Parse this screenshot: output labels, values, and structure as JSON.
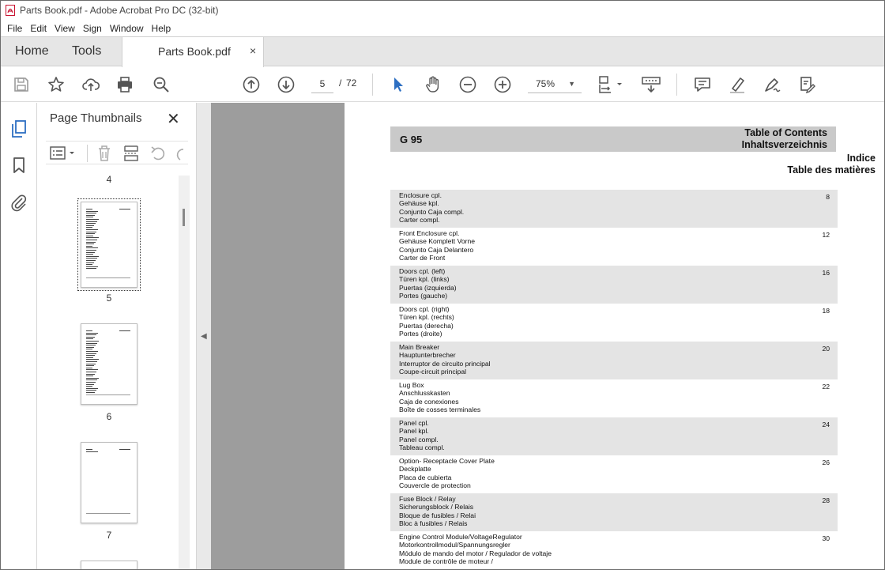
{
  "window": {
    "title": "Parts Book.pdf - Adobe Acrobat Pro DC (32-bit)"
  },
  "menu": [
    "File",
    "Edit",
    "View",
    "Sign",
    "Window",
    "Help"
  ],
  "tabs": {
    "home": "Home",
    "tools": "Tools",
    "document": "Parts Book.pdf",
    "close": "×"
  },
  "toolbar": {
    "current_page": "5",
    "separator": "/",
    "total_pages": "72",
    "zoom": "75%",
    "icons": [
      "save-icon",
      "bookmark-star-icon",
      "upload-cloud-icon",
      "print-icon",
      "find-zoom-icon",
      "previous-page-icon",
      "next-page-icon",
      "select-cursor-icon",
      "hand-pan-icon",
      "zoom-out-icon",
      "zoom-in-icon",
      "page-fit-icon",
      "scroll-mode-icon",
      "comment-icon",
      "highlight-pen-icon",
      "sign-pen-icon",
      "fill-sign-icon"
    ]
  },
  "colors": {
    "accent_blue": "#2d6fc2",
    "page_bg": "#9d9d9d",
    "band": "#c9c9c9",
    "row_shade": "#e4e4e4"
  },
  "thumbnails": {
    "title": "Page Thumbnails",
    "close": "✕",
    "pages": [
      {
        "num": "4"
      },
      {
        "num": "5",
        "selected": true
      },
      {
        "num": "6"
      },
      {
        "num": "7"
      }
    ]
  },
  "pdf": {
    "model": "G 95",
    "toc_title": [
      "Table of Contents",
      "Inhaltsverzeichnis"
    ],
    "toc_sub": [
      "Indice",
      "Table des matières"
    ],
    "entries": [
      {
        "lines": [
          "Enclosure cpl.",
          "Gehäuse kpl.",
          "Conjunto Caja compl.",
          "Carter compl."
        ],
        "page": "8",
        "shaded": true
      },
      {
        "lines": [
          "Front Enclosure cpl.",
          "Gehäuse Komplett Vorne",
          "Conjunto Caja Delantero",
          "Carter de Front"
        ],
        "page": "12",
        "shaded": false
      },
      {
        "lines": [
          "Doors cpl. (left)",
          "Türen kpl. (links)",
          "Puertas (izquierda)",
          "Portes (gauche)"
        ],
        "page": "16",
        "shaded": true
      },
      {
        "lines": [
          "Doors cpl. (right)",
          "Türen kpl. (rechts)",
          "Puertas (derecha)",
          "Portes (droite)"
        ],
        "page": "18",
        "shaded": false
      },
      {
        "lines": [
          "Main Breaker",
          "Hauptunterbrecher",
          "Interruptor de circuito principal",
          "Coupe-circuit principal"
        ],
        "page": "20",
        "shaded": true
      },
      {
        "lines": [
          "Lug Box",
          "Anschlusskasten",
          "Caja de conexiones",
          "Boîte de cosses terminales"
        ],
        "page": "22",
        "shaded": false
      },
      {
        "lines": [
          "Panel cpl.",
          "Panel kpl.",
          "Panel compl.",
          "Tableau compl."
        ],
        "page": "24",
        "shaded": true
      },
      {
        "lines": [
          "Option- Receptacle Cover Plate",
          "Deckplatte",
          "Placa de cubierta",
          "Couvercle de protection"
        ],
        "page": "26",
        "shaded": false
      },
      {
        "lines": [
          "Fuse Block / Relay",
          "Sicherungsblock / Relais",
          "Bloque de fusibles / Relai",
          "Bloc à fusibles / Relais"
        ],
        "page": "28",
        "shaded": true
      },
      {
        "lines": [
          "Engine Control Module/VoltageRegulator",
          "Motorkontrollmodul/Spannungsregler",
          "Módulo de mando del motor / Regulador de voltaje",
          "Module de contrôle de moteur /"
        ],
        "page": "30",
        "shaded": false
      }
    ]
  }
}
